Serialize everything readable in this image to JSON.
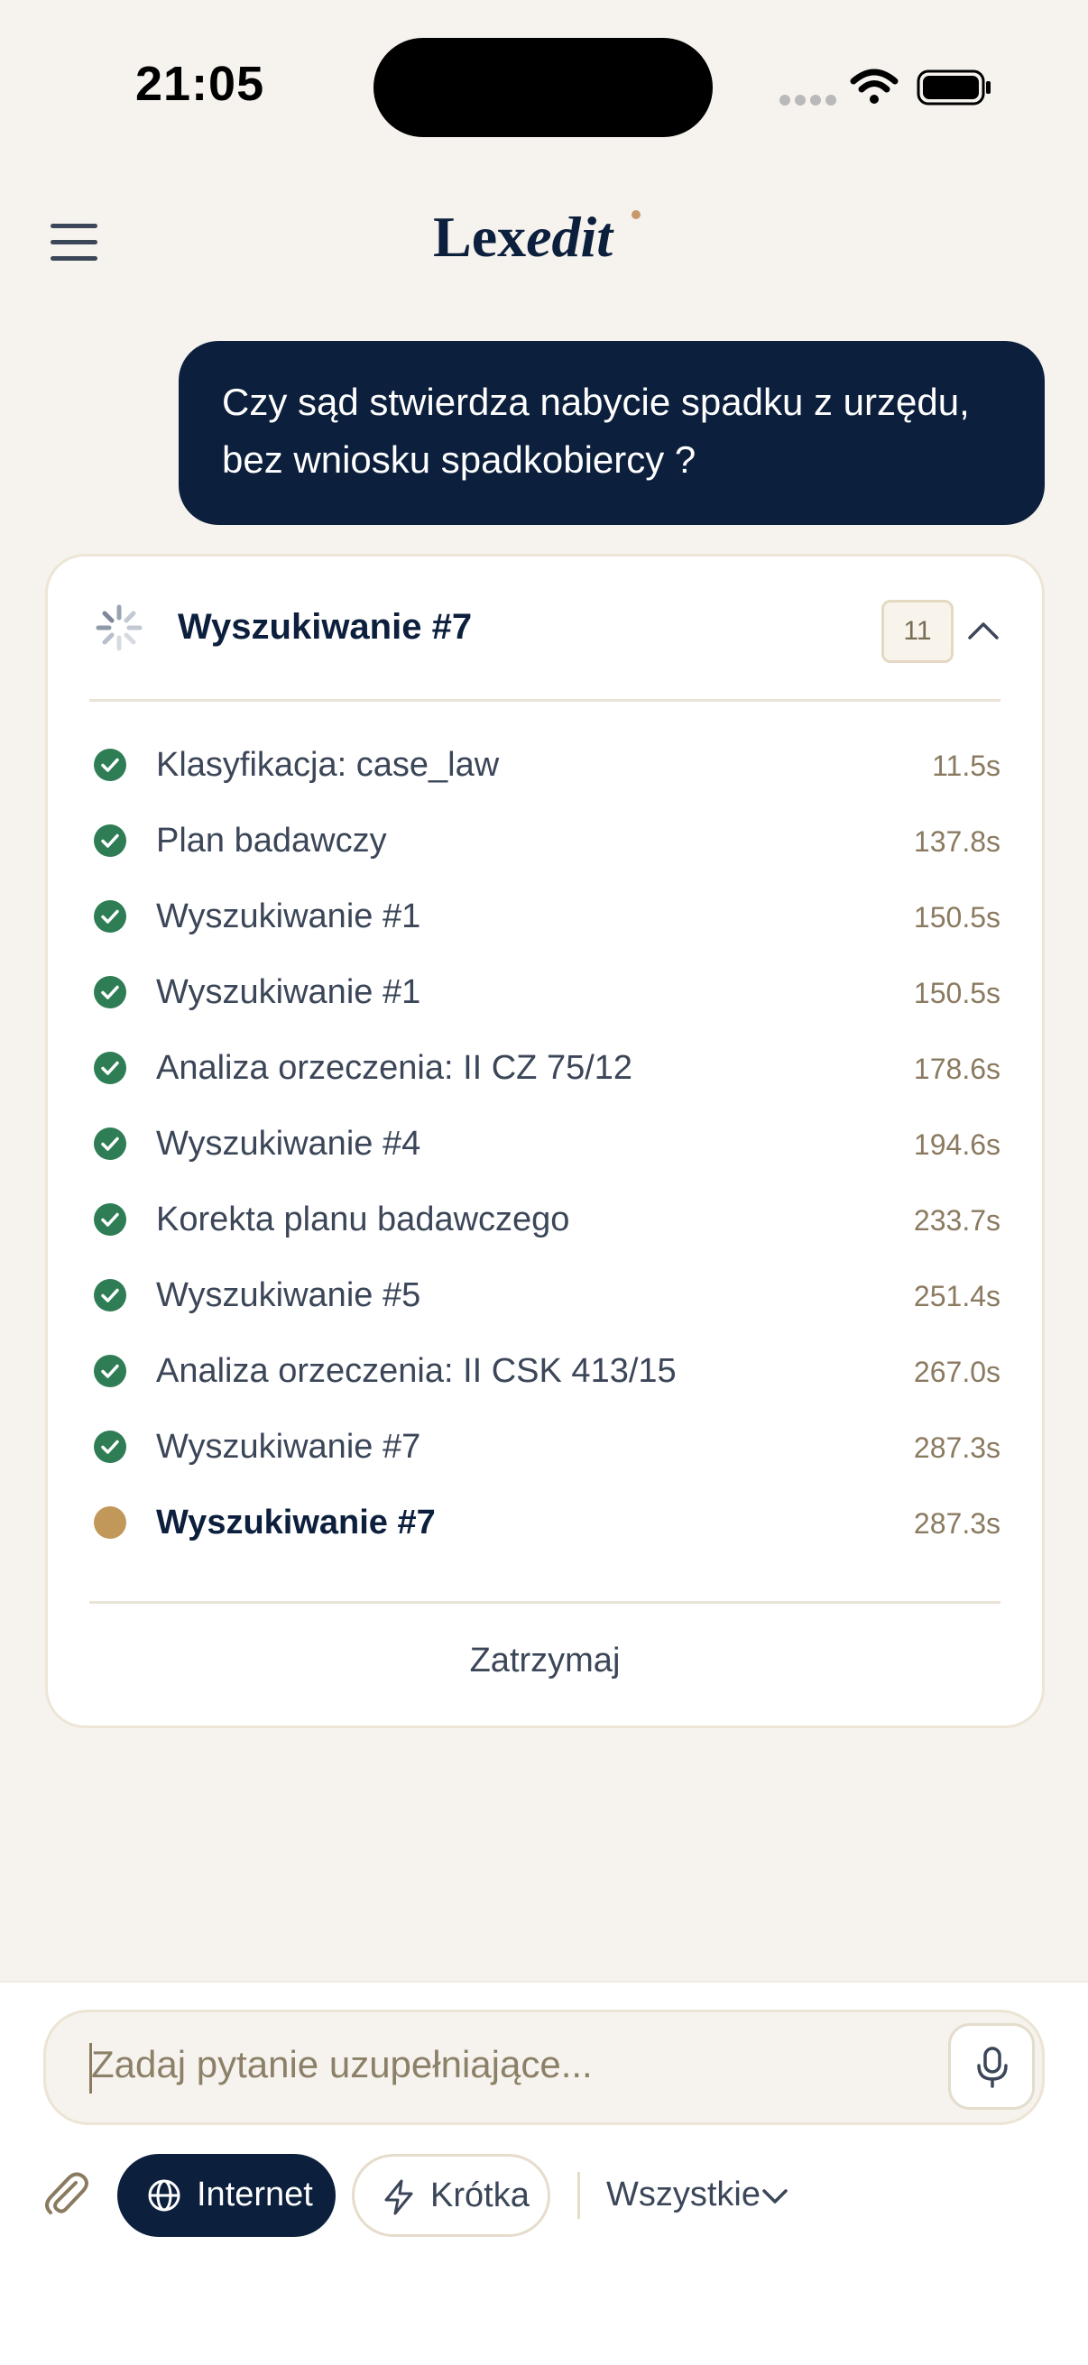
{
  "status_bar": {
    "time": "21:05"
  },
  "header": {
    "logo_main": "Lex",
    "logo_italic": "edit"
  },
  "user_message": {
    "lines": [
      "Czy sąd stwierdza nabycie spadku z urzędu,",
      "bez wniosku spadkobiercy ?"
    ]
  },
  "progress": {
    "title": "Wyszukiwanie #7",
    "count": "11",
    "steps": [
      {
        "label": "Klasyfikacja: case_law",
        "time": "11.5s",
        "status": "done"
      },
      {
        "label": "Plan badawczy",
        "time": "137.8s",
        "status": "done"
      },
      {
        "label": "Wyszukiwanie #1",
        "time": "150.5s",
        "status": "done"
      },
      {
        "label": "Wyszukiwanie #1",
        "time": "150.5s",
        "status": "done"
      },
      {
        "label": "Analiza orzeczenia: II CZ 75/12",
        "time": "178.6s",
        "status": "done"
      },
      {
        "label": "Wyszukiwanie #4",
        "time": "194.6s",
        "status": "done"
      },
      {
        "label": "Korekta planu badawczego",
        "time": "233.7s",
        "status": "done"
      },
      {
        "label": "Wyszukiwanie #5",
        "time": "251.4s",
        "status": "done"
      },
      {
        "label": "Analiza orzeczenia: II CSK 413/15",
        "time": "267.0s",
        "status": "done"
      },
      {
        "label": "Wyszukiwanie #7",
        "time": "287.3s",
        "status": "done"
      },
      {
        "label": "Wyszukiwanie #7",
        "time": "287.3s",
        "status": "active"
      }
    ],
    "stop_label": "Zatrzymaj"
  },
  "composer": {
    "placeholder": "Zadaj pytanie uzupełniające...",
    "internet_label": "Internet",
    "short_label": "Krótka",
    "filter_label": "Wszystkie"
  },
  "colors": {
    "navy": "#0c1f3d",
    "success": "#2e7d55",
    "pending": "#c2975a",
    "background": "#f6f3ee"
  },
  "icons": {
    "menu": "hamburger-icon",
    "spinner": "loading-spinner-icon",
    "collapse": "chevron-up-icon",
    "done": "check-circle-icon",
    "active": "pending-dot-icon",
    "mic": "microphone-icon",
    "attach": "paperclip-icon",
    "internet": "globe-icon",
    "short": "lightning-icon",
    "filter": "chevron-down-icon"
  }
}
